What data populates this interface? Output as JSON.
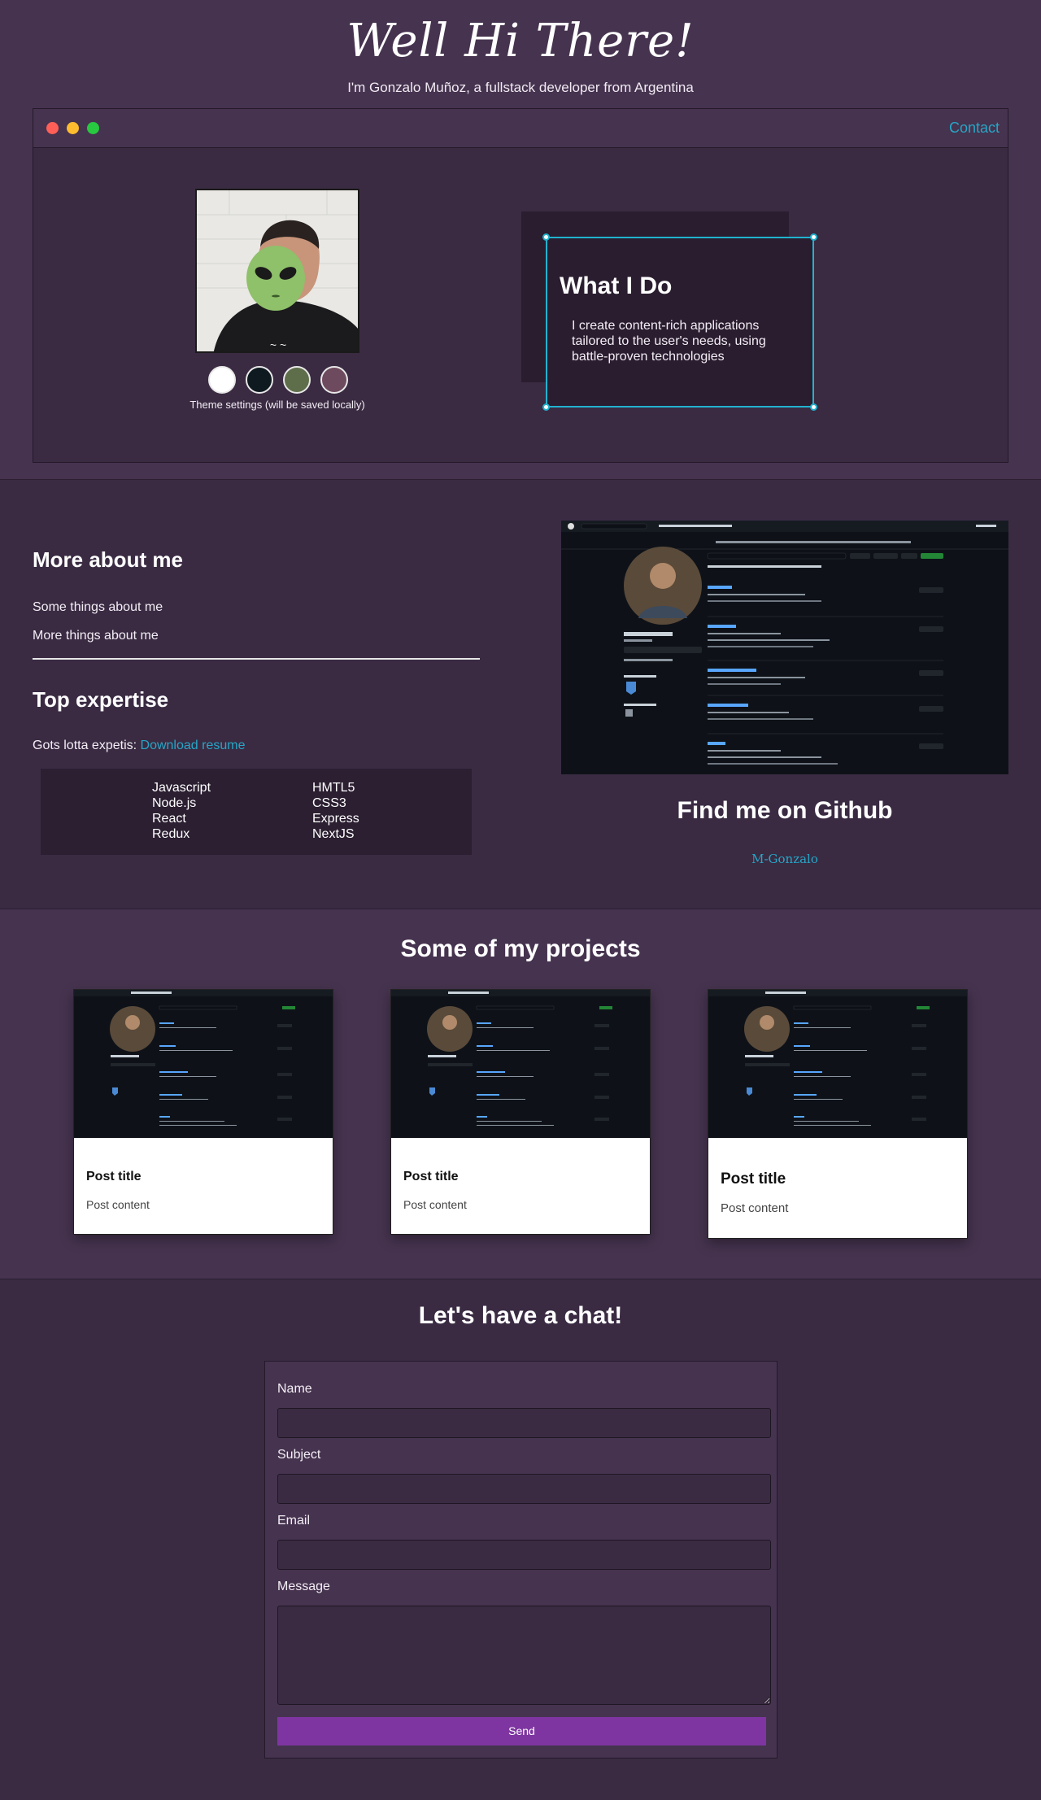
{
  "hero": {
    "title": "Well Hi There!",
    "intro": "I'm Gonzalo Muñoz, a fullstack developer from Argentina",
    "contact_link": "Contact",
    "theme_label": "Theme settings (will be saved locally)",
    "theme_swatches": [
      "#ffffff",
      "#0f1a20",
      "#5f6e4a",
      "#6e4a5e"
    ],
    "widget": {
      "title": "What I Do",
      "text": "I create content-rich applications tailored to the user's needs, using battle-proven technologies"
    }
  },
  "about": {
    "heading": "More about me",
    "lines": [
      "Some things about me",
      "More things about me"
    ],
    "expertise_heading": "Top expertise",
    "expertise_prefix": "Gots lotta expetis: ",
    "resume_link": "Download resume",
    "skills_left": [
      "Javascript",
      "Node.js",
      "React",
      "Redux"
    ],
    "skills_right": [
      "HMTL5",
      "CSS3",
      "Express",
      "NextJS"
    ],
    "github_title": "Find me on Github",
    "github_user": "M-Gonzalo"
  },
  "projects": {
    "heading": "Some of my projects",
    "cards": [
      {
        "title": "Post title",
        "content": "Post content"
      },
      {
        "title": "Post title",
        "content": "Post content"
      },
      {
        "title": "Post title",
        "content": "Post content"
      }
    ]
  },
  "contact": {
    "heading": "Let's have a chat!",
    "name_label": "Name",
    "subject_label": "Subject",
    "email_label": "Email",
    "message_label": "Message",
    "send_label": "Send"
  },
  "colors": {
    "accent": "#27a6c6",
    "send": "#7e35a1",
    "bg": "#46334f"
  }
}
